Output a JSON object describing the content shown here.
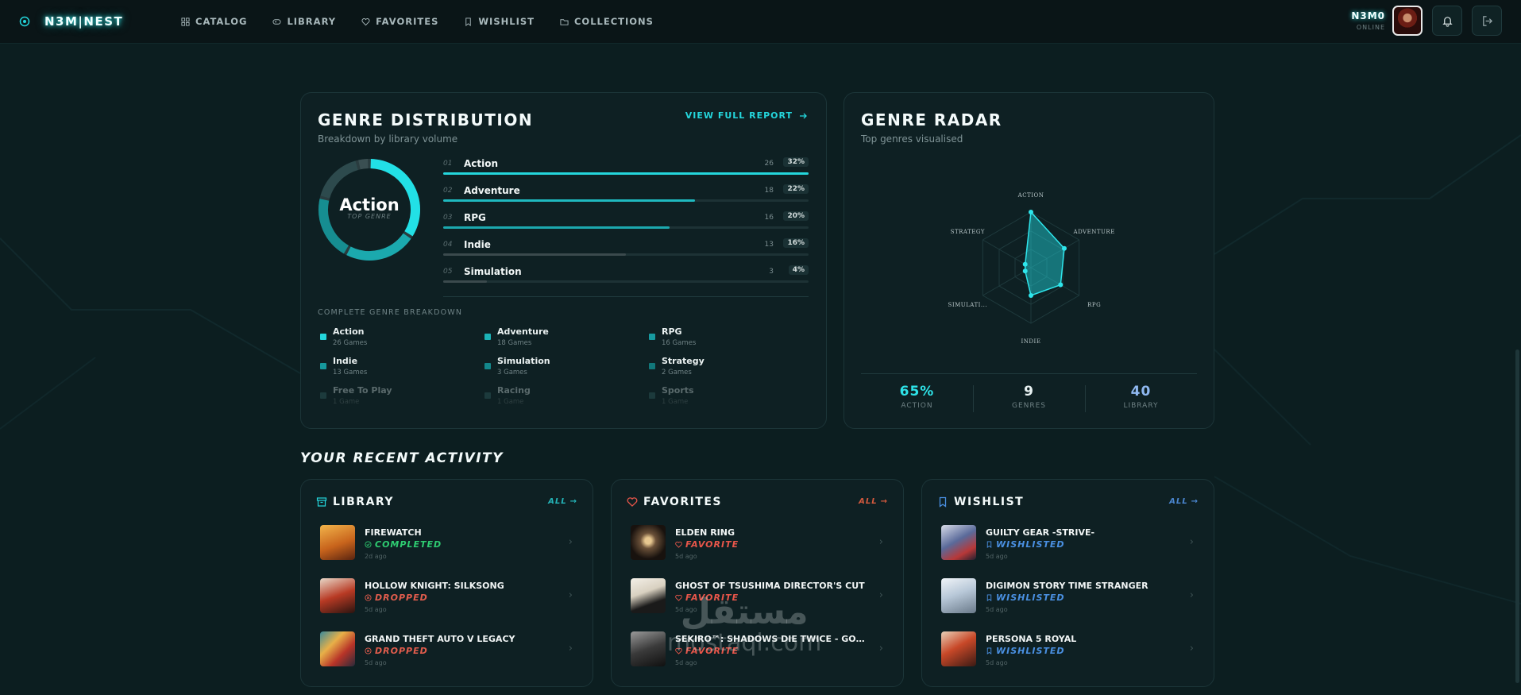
{
  "brand": {
    "name": "N3M|NEST"
  },
  "nav": {
    "links": [
      {
        "label": "CATALOG",
        "icon": "grid-icon"
      },
      {
        "label": "LIBRARY",
        "icon": "gamepad-icon"
      },
      {
        "label": "FAVORITES",
        "icon": "heart-icon"
      },
      {
        "label": "WISHLIST",
        "icon": "bookmark-icon"
      },
      {
        "label": "COLLECTIONS",
        "icon": "folder-icon"
      }
    ]
  },
  "user": {
    "name": "N3M0",
    "status": "ONLINE"
  },
  "colors": {
    "accent": "#24d6dc",
    "favorite": "#e8564a",
    "wishlist": "#4a90e2",
    "completed": "#2ecc71",
    "dropped": "#e25d4d"
  },
  "genre_distribution": {
    "title": "GENRE DISTRIBUTION",
    "subtitle": "Breakdown by library volume",
    "report_link": "VIEW FULL REPORT",
    "top_genre": "Action",
    "top_genre_label": "TOP GENRE",
    "bars": [
      {
        "num": "01",
        "name": "Action",
        "count": "26",
        "pct": "32%",
        "ratio": 1.0
      },
      {
        "num": "02",
        "name": "Adventure",
        "count": "18",
        "pct": "22%",
        "ratio": 0.69
      },
      {
        "num": "03",
        "name": "RPG",
        "count": "16",
        "pct": "20%",
        "ratio": 0.62
      },
      {
        "num": "04",
        "name": "Indie",
        "count": "13",
        "pct": "16%",
        "ratio": 0.5
      },
      {
        "num": "05",
        "name": "Simulation",
        "count": "3",
        "pct": "4%",
        "ratio": 0.12
      }
    ],
    "breakdown_title": "COMPLETE GENRE BREAKDOWN",
    "breakdown": [
      {
        "name": "Action",
        "count": "26 Games"
      },
      {
        "name": "Adventure",
        "count": "18 Games"
      },
      {
        "name": "RPG",
        "count": "16 Games"
      },
      {
        "name": "Indie",
        "count": "13 Games"
      },
      {
        "name": "Simulation",
        "count": "3 Games"
      },
      {
        "name": "Strategy",
        "count": "2 Games"
      },
      {
        "name": "Free To Play",
        "count": "1 Game"
      },
      {
        "name": "Racing",
        "count": "1 Game"
      },
      {
        "name": "Sports",
        "count": "1 Game"
      }
    ]
  },
  "genre_radar": {
    "title": "GENRE RADAR",
    "subtitle": "Top genres visualised",
    "axes": [
      "ACTION",
      "ADVENTURE",
      "RPG",
      "INDIE",
      "SIMULATI...",
      "STRATEGY"
    ],
    "values": [
      26,
      18,
      16,
      13,
      3,
      2
    ],
    "stats": [
      {
        "value": "65%",
        "label": "ACTION"
      },
      {
        "value": "9",
        "label": "GENRES"
      },
      {
        "value": "40",
        "label": "LIBRARY"
      }
    ]
  },
  "recent": {
    "title": "YOUR RECENT ACTIVITY",
    "library": {
      "title": "LIBRARY",
      "all": "ALL",
      "items": [
        {
          "name": "FIREWATCH",
          "status": "COMPLETED",
          "time": "2d ago"
        },
        {
          "name": "HOLLOW KNIGHT: SILKSONG",
          "status": "DROPPED",
          "time": "5d ago"
        },
        {
          "name": "GRAND THEFT AUTO V LEGACY",
          "status": "DROPPED",
          "time": "5d ago"
        }
      ]
    },
    "favorites": {
      "title": "FAVORITES",
      "all": "ALL",
      "items": [
        {
          "name": "ELDEN RING",
          "status": "FAVORITE",
          "time": "5d ago"
        },
        {
          "name": "GHOST OF TSUSHIMA DIRECTOR'S CUT",
          "status": "FAVORITE",
          "time": "5d ago"
        },
        {
          "name": "SEKIRO™: SHADOWS DIE TWICE - GOTY ED...",
          "status": "FAVORITE",
          "time": "5d ago"
        }
      ]
    },
    "wishlist": {
      "title": "WISHLIST",
      "all": "ALL",
      "items": [
        {
          "name": "GUILTY GEAR -STRIVE-",
          "status": "WISHLISTED",
          "time": "5d ago"
        },
        {
          "name": "DIGIMON STORY TIME STRANGER",
          "status": "WISHLISTED",
          "time": "5d ago"
        },
        {
          "name": "PERSONA 5 ROYAL",
          "status": "WISHLISTED",
          "time": "5d ago"
        }
      ]
    }
  },
  "watermark": {
    "arabic": "مستقل",
    "latin": "mostaql.com"
  }
}
